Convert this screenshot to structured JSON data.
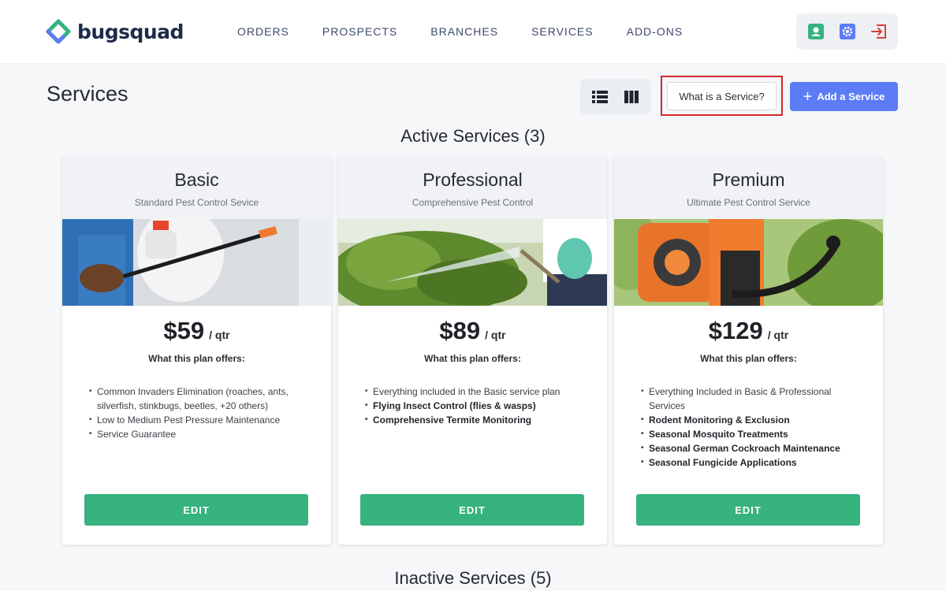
{
  "brand": {
    "name": "bugsquad",
    "primary": "#5b7cf5",
    "accent_green": "#36b37e"
  },
  "nav": {
    "links": [
      "ORDERS",
      "PROSPECTS",
      "BRANCHES",
      "SERVICES",
      "ADD-ONS"
    ],
    "icons": [
      "user-card-icon",
      "settings-gear-icon",
      "sign-out-icon"
    ]
  },
  "page": {
    "title": "Services",
    "help_button": "What is a Service?",
    "add_button": "Add a Service",
    "view_toggle_icons": [
      "list-view-icon",
      "column-view-icon"
    ]
  },
  "sections": {
    "active_title": "Active Services (3)",
    "inactive_title": "Inactive Services (5)"
  },
  "cards": [
    {
      "name": "Basic",
      "subtitle": "Standard Pest Control Sevice",
      "price": "$59",
      "period": "/ qtr",
      "offers_title": "What this plan offers:",
      "features": [
        "Common Invaders Elimination (roaches, ants, silverfish, stinkbugs, beetles, +20 others)",
        "Low to Medium Pest Pressure Maintenance",
        "Service Guarantee"
      ],
      "edit_label": "EDIT"
    },
    {
      "name": "Professional",
      "subtitle": "Comprehensive Pest Control",
      "price": "$89",
      "period": "/ qtr",
      "offers_title": "What this plan offers:",
      "features": [
        "Everything included in the Basic service plan",
        "Flying Insect Control (flies & wasps)",
        "Comprehensive Termite Monitoring"
      ],
      "edit_label": "EDIT"
    },
    {
      "name": "Premium",
      "subtitle": "Ultimate Pest Control Service",
      "price": "$129",
      "period": "/ qtr",
      "offers_title": "What this plan offers:",
      "features": [
        "Everything Included in Basic & Professional Services",
        "Rodent Monitoring & Exclusion",
        "Seasonal Mosquito Treatments",
        "Seasonal German Cockroach Maintenance",
        "Seasonal Fungicide Applications"
      ],
      "edit_label": "EDIT"
    }
  ]
}
